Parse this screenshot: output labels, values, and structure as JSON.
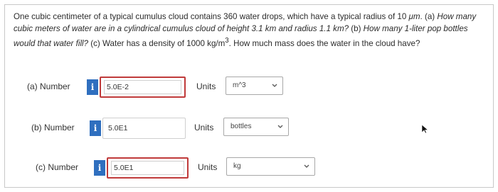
{
  "question": {
    "s1": "One cubic centimeter of a typical cumulus cloud contains 360 water drops, which have a typical radius of 10 ",
    "unit_um": "μm",
    "s2": ". ",
    "part_a_tag": "(a)",
    "part_a_text": " How many cubic meters of water are in a cylindrical cumulus cloud of height 3.1 km and radius 1.1 km? ",
    "part_b_tag": "(b)",
    "part_b_text": " How many 1-liter pop bottles would that water fill? ",
    "part_c_tag": "(c)",
    "part_c_text": " Water has a density of 1000 kg/m",
    "superscript": "3",
    "part_c_text2": ". How much mass does the water in the cloud have?"
  },
  "rows": [
    {
      "label": "(a)  Number",
      "info_icon": "i",
      "answer": "5.0E-2",
      "units_label": "Units",
      "units_value": "m^3",
      "answer_state": "incorrect"
    },
    {
      "label": "(b)  Number",
      "info_icon": "i",
      "answer": "5.0E1",
      "units_label": "Units",
      "units_value": "bottles",
      "answer_state": "neutral"
    },
    {
      "label": "(c)  Number",
      "info_icon": "i",
      "answer": "5.0E1",
      "units_label": "Units",
      "units_value": "kg",
      "answer_state": "incorrect"
    }
  ],
  "colors": {
    "incorrect_border": "#c03a3a",
    "info_icon_bg": "#2f6fbf"
  },
  "icons": {
    "info": "info-icon",
    "dropdown": "chevron-down-icon",
    "cursor": "mouse-pointer-icon"
  }
}
